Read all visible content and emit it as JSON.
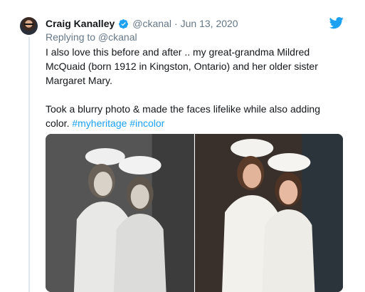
{
  "tweet": {
    "author": {
      "name": "Craig Kanalley",
      "handle": "@ckanal",
      "verified": true,
      "avatar_icon": "avatar-photo"
    },
    "separator": "·",
    "date": "Jun 13, 2020",
    "replying_prefix": "Replying to",
    "replying_handle": "@ckanal",
    "text_line_1": "I also love this before and after ..  my great-grandma Mildred McQuaid (born 1912 in Kingston, Ontario) and her older sister Margaret Mary.",
    "text_line_2_plain": "Took a blurry photo & made the faces lifelike while also adding color.",
    "hashtags": [
      "#myheritage",
      "#incolor"
    ],
    "media": {
      "left_icon": "photo-before-black-and-white",
      "right_icon": "photo-after-colorized"
    },
    "brand_icon": "twitter-bird-icon",
    "colors": {
      "accent": "#1da1f2",
      "muted": "#657786",
      "text": "#14171a"
    }
  }
}
